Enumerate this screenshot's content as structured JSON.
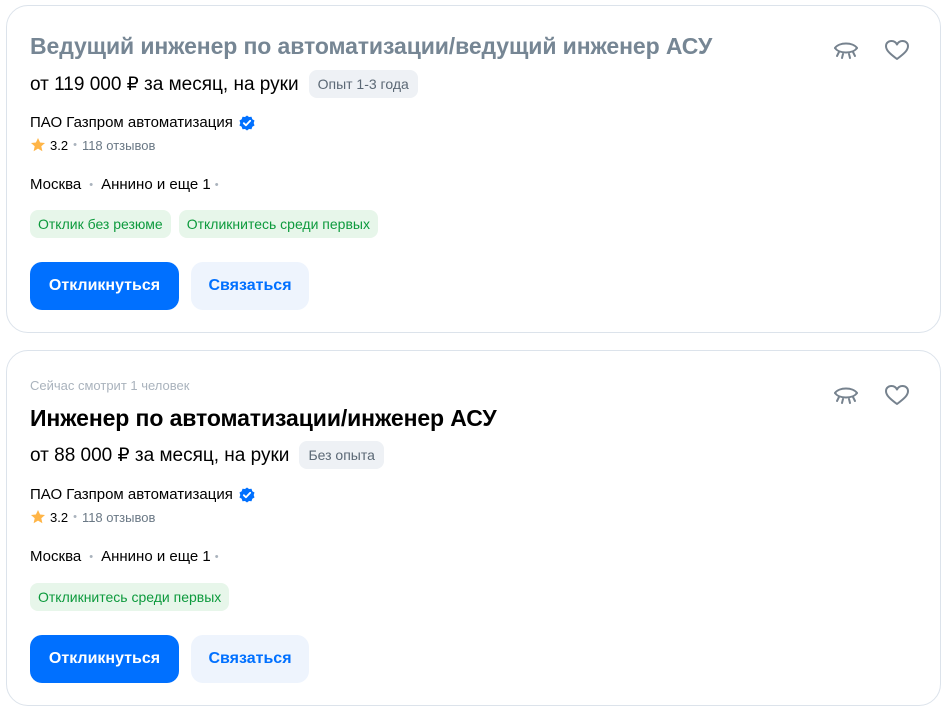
{
  "vacancies": [
    {
      "viewing_now": "",
      "title": "Ведущий инженер по автоматизации/ведущий инженер АСУ",
      "salary": "от 119 000 ₽ за месяц, на руки",
      "experience": "Опыт 1-3 года",
      "company": "ПАО Газпром автоматизация",
      "rating": "3.2",
      "reviews": "118 отзывов",
      "city": "Москва",
      "metro": "Аннино и еще 1",
      "tags": [
        "Отклик без резюме",
        "Откликнитесь среди первых"
      ],
      "apply_label": "Откликнуться",
      "contact_label": "Связаться"
    },
    {
      "viewing_now": "Сейчас смотрит 1 человек",
      "title": "Инженер по автоматизации/инженер АСУ",
      "salary": "от 88 000 ₽ за месяц, на руки",
      "experience": "Без опыта",
      "company": "ПАО Газпром автоматизация",
      "rating": "3.2",
      "reviews": "118 отзывов",
      "city": "Москва",
      "metro": "Аннино и еще 1",
      "tags": [
        "Откликнитесь среди первых"
      ],
      "apply_label": "Откликнуться",
      "contact_label": "Связаться"
    }
  ],
  "icons": {
    "hide": "eye-closed-icon",
    "favorite": "heart-icon",
    "verified": "verified-check-icon",
    "star": "star-icon"
  },
  "colors": {
    "accent": "#0070ff",
    "tag_text": "#0d9a3d",
    "tag_bg": "#e7f6ea",
    "star": "#ffb547",
    "viewed_title": "#768694"
  }
}
